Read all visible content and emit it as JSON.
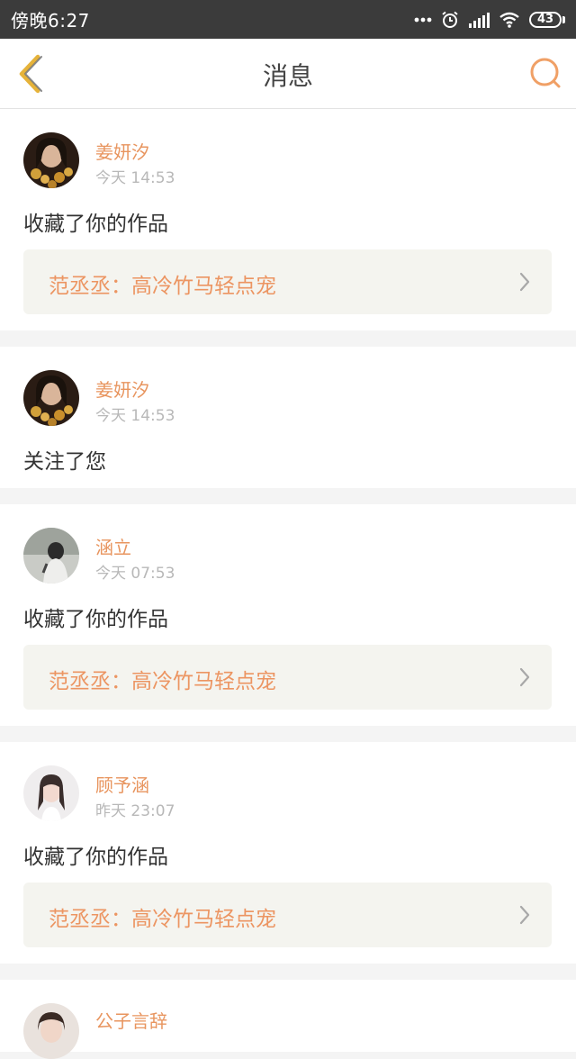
{
  "status_bar": {
    "time": "傍晚6:27",
    "battery": "43"
  },
  "header": {
    "title": "消息"
  },
  "messages": [
    {
      "name": "姜妍汐",
      "time": "今天 14:53",
      "action": "收藏了你的作品",
      "work": "范丞丞：高冷竹马轻点宠"
    },
    {
      "name": "姜妍汐",
      "time": "今天 14:53",
      "action": "关注了您"
    },
    {
      "name": "涵立",
      "time": "今天 07:53",
      "action": "收藏了你的作品",
      "work": "范丞丞：高冷竹马轻点宠"
    },
    {
      "name": "顾予涵",
      "time": "昨天 23:07",
      "action": "收藏了你的作品",
      "work": "范丞丞：高冷竹马轻点宠"
    },
    {
      "name": "公子言辞"
    }
  ],
  "colors": {
    "accent": "#e8955f",
    "status_bar": "#3b3b3b",
    "back_icon": "#e6b33a",
    "link_bg": "#f4f4ef"
  }
}
